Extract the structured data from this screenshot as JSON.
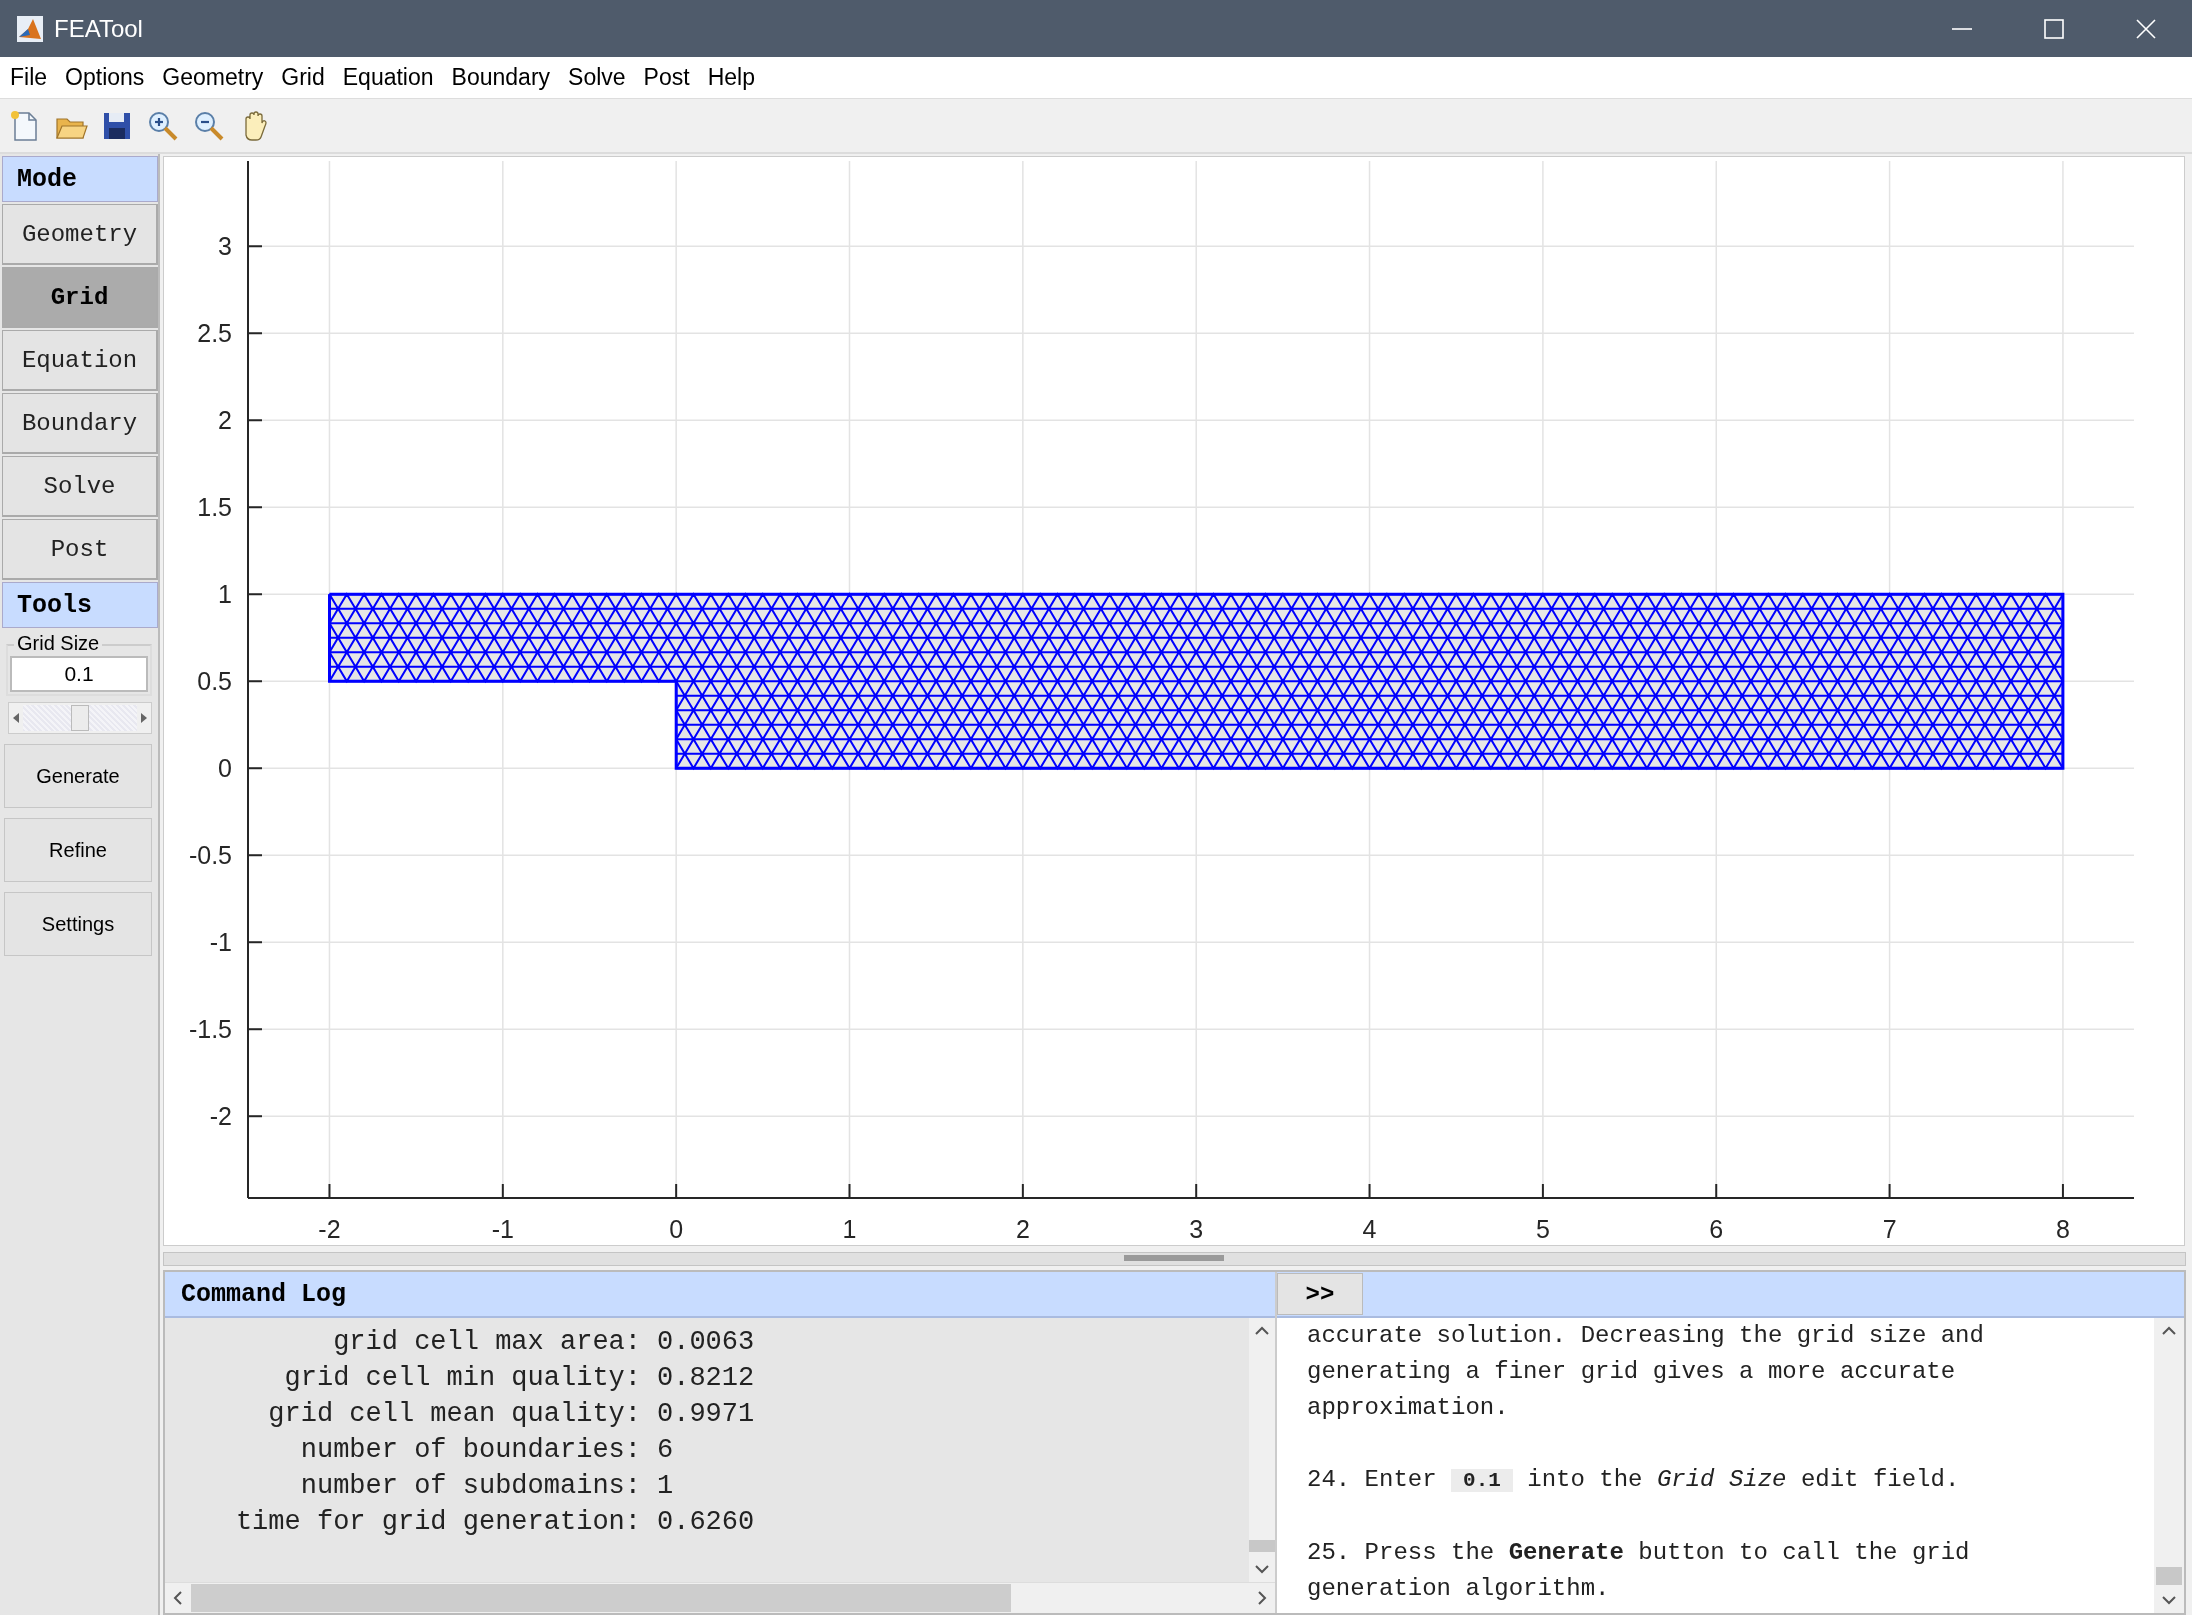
{
  "window": {
    "title": "FEATool"
  },
  "menu": [
    "File",
    "Options",
    "Geometry",
    "Grid",
    "Equation",
    "Boundary",
    "Solve",
    "Post",
    "Help"
  ],
  "toolbar": [
    {
      "kind": "new"
    },
    {
      "kind": "open"
    },
    {
      "kind": "save"
    },
    {
      "kind": "zoom_in"
    },
    {
      "kind": "zoom_out"
    },
    {
      "kind": "pan"
    }
  ],
  "mode_panel": {
    "title": "Mode",
    "modes": [
      {
        "label": "Geometry",
        "selected": false
      },
      {
        "label": "Grid",
        "selected": true
      },
      {
        "label": "Equation",
        "selected": false
      },
      {
        "label": "Boundary",
        "selected": false
      },
      {
        "label": "Solve",
        "selected": false
      },
      {
        "label": "Post",
        "selected": false
      }
    ]
  },
  "tools_panel": {
    "title": "Tools",
    "grid_size": {
      "label": "Grid Size",
      "value": "0.1",
      "level": 0.5
    },
    "buttons": [
      "Generate",
      "Refine",
      "Settings"
    ]
  },
  "plot": {
    "x_tick_labels": [
      "-2",
      "-1",
      "0",
      "1",
      "2",
      "3",
      "4",
      "5",
      "6",
      "7",
      "8"
    ],
    "y_tick_labels": [
      "3",
      "2.5",
      "2",
      "1.5",
      "1",
      "0.5",
      "0",
      "-0.5",
      "-1",
      "-1.5",
      "-2"
    ]
  },
  "command_log": {
    "title": "Command Log",
    "lines": [
      {
        "label": "grid cell max area:",
        "value": "0.0063"
      },
      {
        "label": "grid cell min quality:",
        "value": "0.8212"
      },
      {
        "label": "grid cell mean quality:",
        "value": "0.9971"
      },
      {
        "label": "number of boundaries:",
        "value": "6"
      },
      {
        "label": "number of subdomains:",
        "value": "1"
      },
      {
        "label": "time for grid generation:",
        "value": "0.6260"
      }
    ]
  },
  "tutorial": {
    "button": ">>",
    "paragraphs": [
      {
        "text": "accurate solution. Decreasing the grid size and generating a finer grid gives a more accurate approximation."
      },
      {
        "text": "24. Enter",
        "code": "0.1",
        "text_after": "into the *Grid Size* edit field."
      },
      {
        "text": "25. Press the **Generate** button to call the grid generation algorithm."
      }
    ]
  }
}
